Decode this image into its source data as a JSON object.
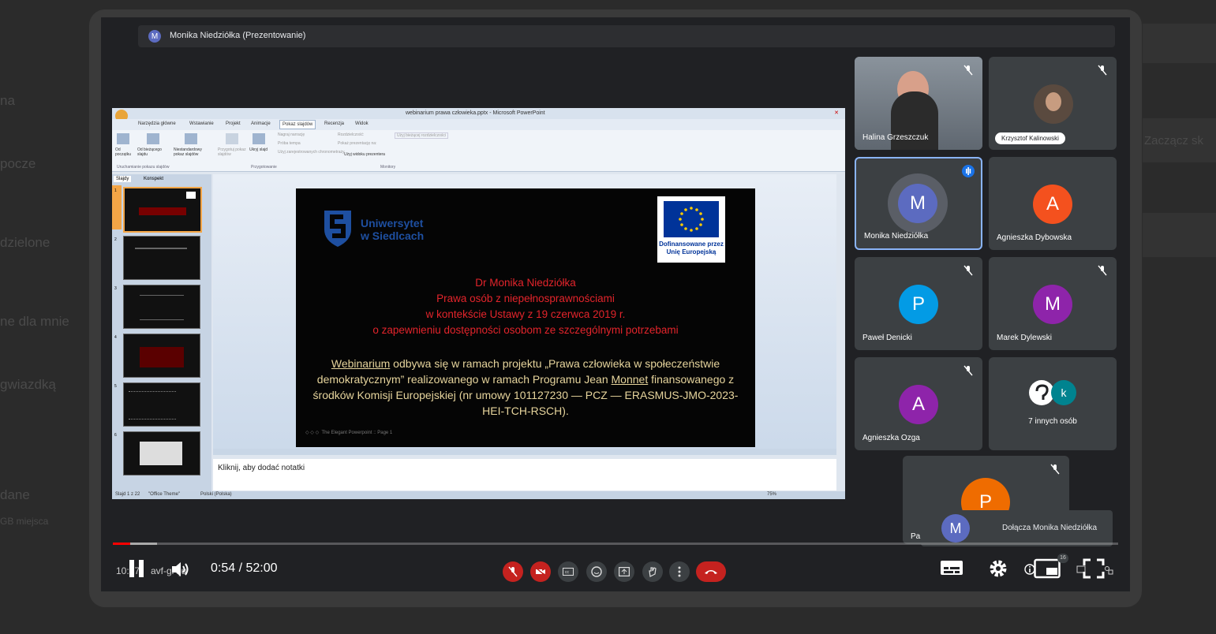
{
  "background": {
    "side_labels": [
      "na",
      "pocze",
      "dzielone",
      "ne dla mnie",
      "gwiazdką",
      "dane",
      "GB miejsca"
    ],
    "right_label": "Zaczącz sk"
  },
  "meet": {
    "presenter_initial": "M",
    "presenter_title": "Monika Niedziółka (Prezentowanie)",
    "clock": "10:47",
    "meeting_code": "avf-gi   fju",
    "participants": [
      {
        "name": "Halina Grzeszczuk",
        "initial": "",
        "color": "",
        "muted": true,
        "video": true
      },
      {
        "name": "Krzysztof Kalinowski",
        "initial": "",
        "color": "",
        "muted": true,
        "video": true
      },
      {
        "name": "Monika Niedziółka",
        "initial": "M",
        "color": "#5c6bc0",
        "muted": false,
        "speaking": true
      },
      {
        "name": "Agnieszka Dybowska",
        "initial": "A",
        "color": "#f4511e",
        "muted": false
      },
      {
        "name": "Paweł Denicki",
        "initial": "P",
        "color": "#039be5",
        "muted": true
      },
      {
        "name": "Marek Dylewski",
        "initial": "M",
        "color": "#8e24aa",
        "muted": true
      },
      {
        "name": "Agnieszka Ozga",
        "initial": "A",
        "color": "#8e24aa",
        "muted": true
      },
      {
        "name": "7 innych osób",
        "initial": "k",
        "color": "#00838f",
        "muted": false
      },
      {
        "name": "Pa",
        "initial": "P",
        "color": "#ef6c00",
        "muted": true
      }
    ],
    "toast": {
      "initial": "M",
      "text": "Dołącza Monika Niedziółka"
    },
    "participant_count": "16"
  },
  "powerpoint": {
    "window_title": "webinarium prawa człowieka.pptx - Microsoft PowerPoint",
    "tabs": [
      "Narzędzia główne",
      "Wstawianie",
      "Projekt",
      "Animacje",
      "Pokaz slajdów",
      "Recenzja",
      "Widok"
    ],
    "ribbon_groups": [
      "Uruchamianie pokazu slajdów",
      "Przygotowanie",
      "Monitory"
    ],
    "ribbon_buttons": [
      "Od początku",
      "Od bieżącego slajdu",
      "Niestandardowy pokaz slajdów",
      "Przygotuj pokaz slajdów",
      "Ukryj slajd"
    ],
    "ribbon_options": [
      "Nagraj narrację",
      "Próba tempa",
      "Użyj zarejestrowanych chronometraży",
      "Rozdzielczość:",
      "Pokaż prezentację na:",
      "Użyj bieżącej rozdzielczości",
      "Użyj widoku prezentera"
    ],
    "side_tabs": [
      "Slajdy",
      "Konspekt"
    ],
    "thumb_numbers": [
      "1",
      "2",
      "3",
      "4",
      "5",
      "6"
    ],
    "notes_placeholder": "Kliknij, aby dodać notatki",
    "status_slide": "Slajd 1 z 22",
    "status_theme": "\"Office Theme\"",
    "status_lang": "Polski (Polska)",
    "zoom": "75%"
  },
  "slide": {
    "uni_line1": "Uniwersytet",
    "uni_line2": "w Siedlcach",
    "eu_line1": "Dofinansowane przez",
    "eu_line2": "Unię Europejską",
    "red_lines": [
      "Dr Monika Niedziółka",
      "Prawa osób z niepełnosprawnościami",
      "w kontekście Ustawy z 19 czerwca 2019 r.",
      "o zapewnieniu dostępności osobom ze szczególnymi potrzebami"
    ],
    "body_text_1": "Webinarium",
    "body_text_2": " odbywa się w ramach projektu „Prawa człowieka w społeczeństwie demokratycznym” realizowanego w ramach Programu Jean ",
    "body_text_3": "Monnet",
    "body_text_4": " finansowanego z środków Komisji Europejskiej (nr umowy 101127230 — PCZ — ERASMUS-JMO-2023-HEI-TCH-RSCH).",
    "footer": "The Elegant Powerpoint :: Page 1"
  },
  "player": {
    "time": "0:54 / 52:00",
    "played_fraction": 0.017,
    "buffered_fraction": 0.044
  },
  "colors": {
    "accent_red": "#ff0000",
    "meet_red": "#c5221f",
    "speaking_border": "#8ab4f8"
  }
}
